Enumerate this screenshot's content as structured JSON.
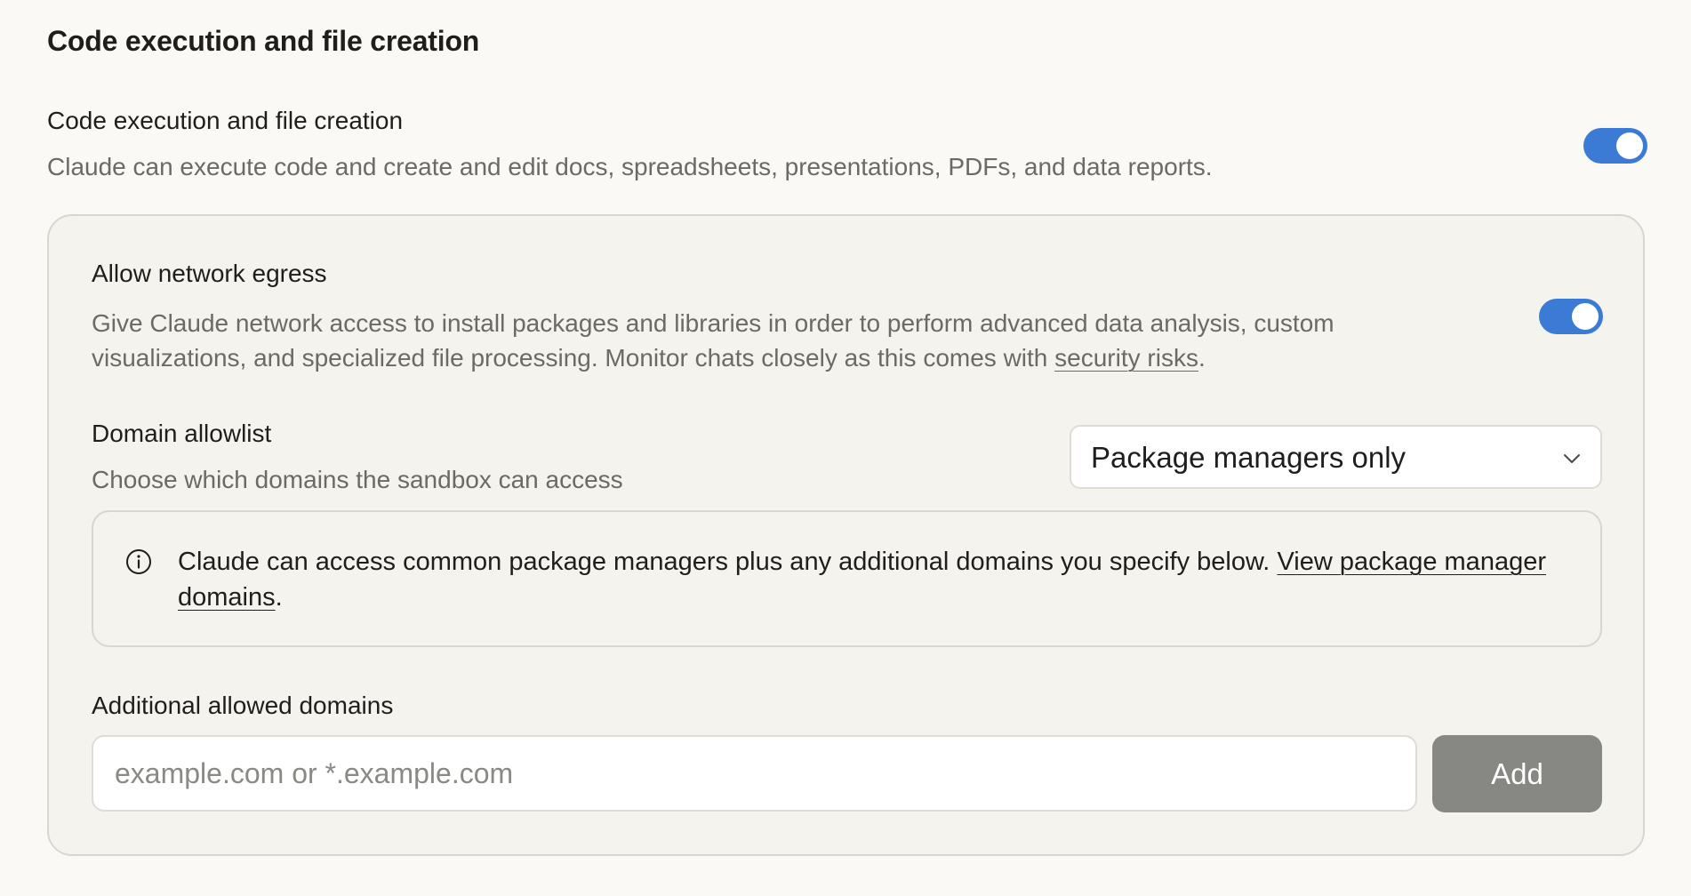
{
  "section": {
    "title": "Code execution and file creation"
  },
  "code_execution": {
    "title": "Code execution and file creation",
    "description": "Claude can execute code and create and edit docs, spreadsheets, presentations, PDFs, and data reports.",
    "enabled": true
  },
  "network_egress": {
    "title": "Allow network egress",
    "description_prefix": "Give Claude network access to install packages and libraries in order to perform advanced data analysis, custom visualizations, and specialized file processing. Monitor chats closely as this comes with ",
    "link_label": "security risks",
    "description_suffix": ".",
    "enabled": true
  },
  "domain_allowlist": {
    "title": "Domain allowlist",
    "description": "Choose which domains the sandbox can access",
    "selected_option": "Package managers only"
  },
  "info_box": {
    "text_prefix": "Claude can access common package managers plus any additional domains you specify below. ",
    "link_label": "View package manager domains",
    "text_suffix": "."
  },
  "additional_domains": {
    "title": "Additional allowed domains",
    "placeholder": "example.com or *.example.com",
    "value": "",
    "add_label": "Add"
  },
  "colors": {
    "toggle_on": "#3b7bd6",
    "page_bg": "#faf9f5",
    "panel_bg": "#f4f3ee",
    "add_button_bg": "#878883"
  }
}
